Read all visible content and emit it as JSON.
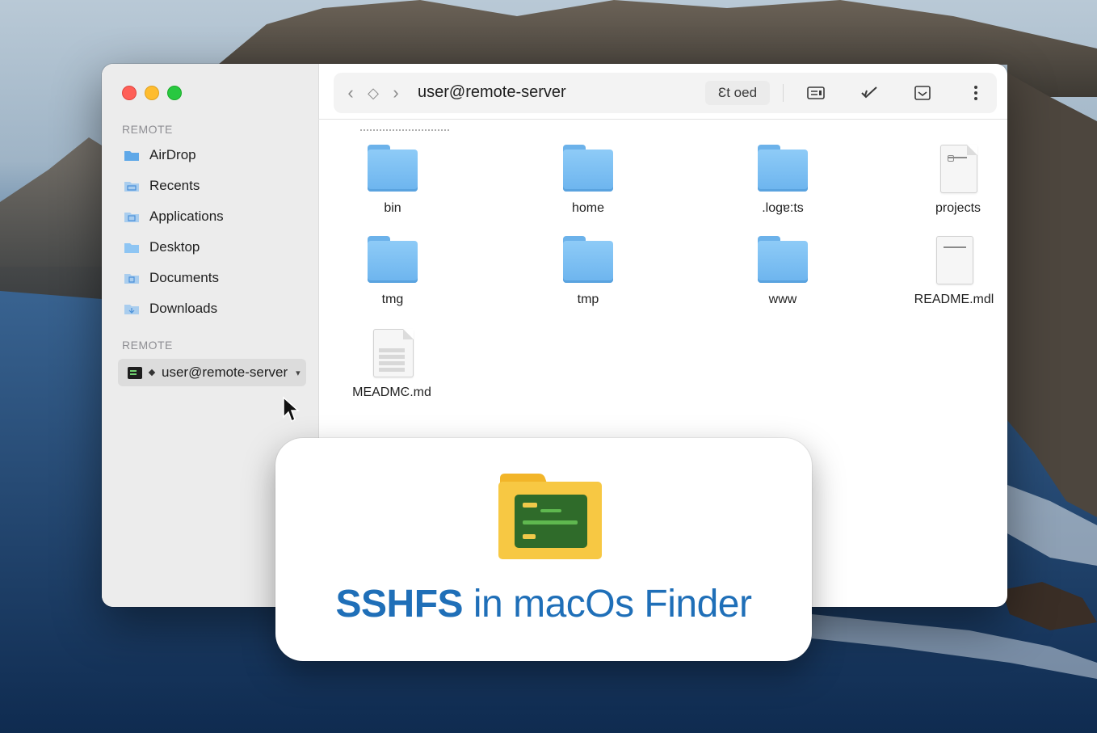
{
  "sidebar": {
    "section_1": "REMOTE",
    "items": [
      {
        "label": "AirDrop",
        "icon": "airdrop-folder-icon"
      },
      {
        "label": "Recents",
        "icon": "recents-folder-icon"
      },
      {
        "label": "Applications",
        "icon": "applications-folder-icon"
      },
      {
        "label": "Desktop",
        "icon": "desktop-folder-icon"
      },
      {
        "label": "Documents",
        "icon": "documents-folder-icon"
      },
      {
        "label": "Downloads",
        "icon": "downloads-folder-icon"
      }
    ],
    "section_2": "REMOTE",
    "server": {
      "label": "user@remote-server",
      "icon": "terminal-icon"
    }
  },
  "toolbar": {
    "title": "user@remote-server",
    "action_label": "Ɛt oed",
    "icons": [
      "back-chevron-icon",
      "path-diamond-icon",
      "forward-chevron-icon",
      "view-icon",
      "check-icon",
      "tray-icon",
      "more-icon"
    ]
  },
  "files": [
    {
      "name": "bin",
      "kind": "folder"
    },
    {
      "name": "home",
      "kind": "folder"
    },
    {
      "name": ".logɐ:ts",
      "kind": "folder"
    },
    {
      "name": "projects",
      "kind": "document"
    },
    {
      "name": "tmg",
      "kind": "folder"
    },
    {
      "name": "tmp",
      "kind": "folder"
    },
    {
      "name": "www",
      "kind": "folder"
    },
    {
      "name": "README.mdl",
      "kind": "document"
    },
    {
      "name": "MEADMϾ.md",
      "kind": "spreadsheet"
    }
  ],
  "card": {
    "title_bold": "SSHFS",
    "title_rest": " in macOs Finder",
    "colors": {
      "title": "#1f6fb8",
      "folder": "#f7c843",
      "terminal": "#2f6b2a"
    }
  },
  "colors": {
    "folder_blue": "#7fc0f3",
    "red": "#fe5f57",
    "yellow": "#febc2e",
    "green": "#28c840"
  }
}
